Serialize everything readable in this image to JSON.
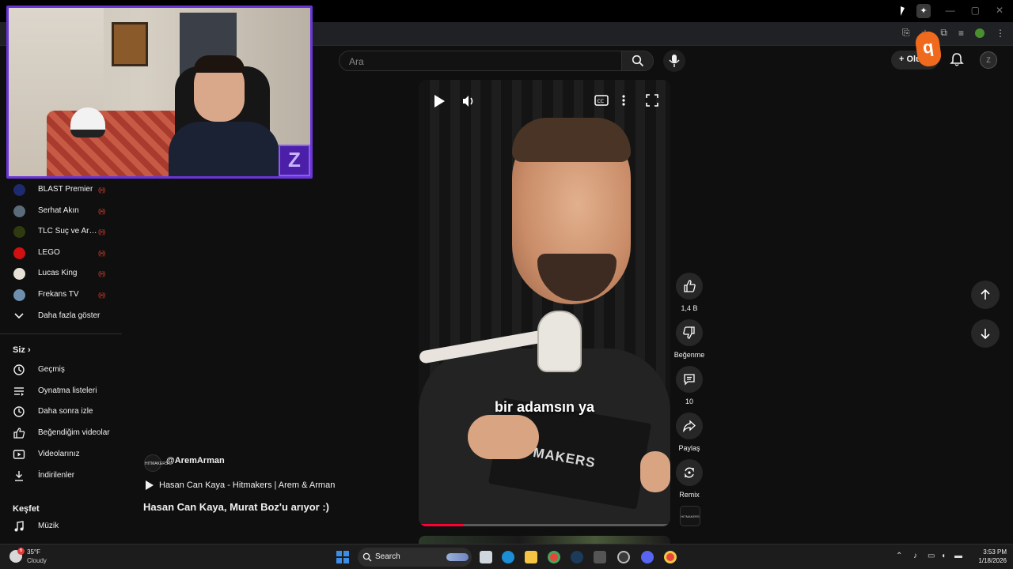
{
  "header": {
    "search_placeholder": "Ara",
    "create_label": "+ Olu",
    "avatar_initials": "Z"
  },
  "overlay": {
    "tag_glyph": "q",
    "webcam_badge": "Z"
  },
  "sidebar": {
    "subscriptions": [
      {
        "label": "BLAST Premier",
        "live": "((•))",
        "color": "#1d2a6e"
      },
      {
        "label": "Serhat Akın",
        "live": "((•))",
        "color": "#5c6b7a"
      },
      {
        "label": "TLC Suç ve Araştırma",
        "live": "((•))",
        "color": "#2f3a10"
      },
      {
        "label": "LEGO",
        "live": "((•))",
        "color": "#d01012"
      },
      {
        "label": "Lucas King",
        "live": "((•))",
        "color": "#e8e2d6"
      },
      {
        "label": "Frekans TV",
        "live": "((•))",
        "color": "#6f8fae"
      }
    ],
    "show_more": "Daha fazla göster",
    "you_title": "Siz",
    "you_items": [
      {
        "label": "Geçmiş",
        "icon": "history-icon"
      },
      {
        "label": "Oynatma listeleri",
        "icon": "playlist-icon"
      },
      {
        "label": "Daha sonra izle",
        "icon": "clock-icon"
      },
      {
        "label": "Beğendiğim videolar",
        "icon": "thumbs-up-icon"
      },
      {
        "label": "Videolarınız",
        "icon": "video-icon"
      },
      {
        "label": "İndirilenler",
        "icon": "download-icon"
      }
    ],
    "explore_title": "Keşfet",
    "explore_items": [
      {
        "label": "Müzik",
        "icon": "music-icon"
      }
    ]
  },
  "video": {
    "caption": "bir adamsın ya",
    "notebook_text": "HITMAKERS",
    "progress": 0.18,
    "channel_logo_text": "HITMAKERS",
    "channel_handle": "@AremArman",
    "related_video": "Hasan Can Kaya - Hitmakers | Arem & Arman",
    "title": "Hasan Can Kaya, Murat Boz'u arıyor :)"
  },
  "actions": {
    "like_count": "1,4 B",
    "dislike_label": "Beğenme",
    "comment_count": "10",
    "share_label": "Paylaş",
    "remix_label": "Remix"
  },
  "taskbar": {
    "temp": "35°F",
    "condition": "Cloudy",
    "weather_badge": "6",
    "search_label": "Search",
    "time": "3:53 PM",
    "date": "1/18/2026"
  }
}
